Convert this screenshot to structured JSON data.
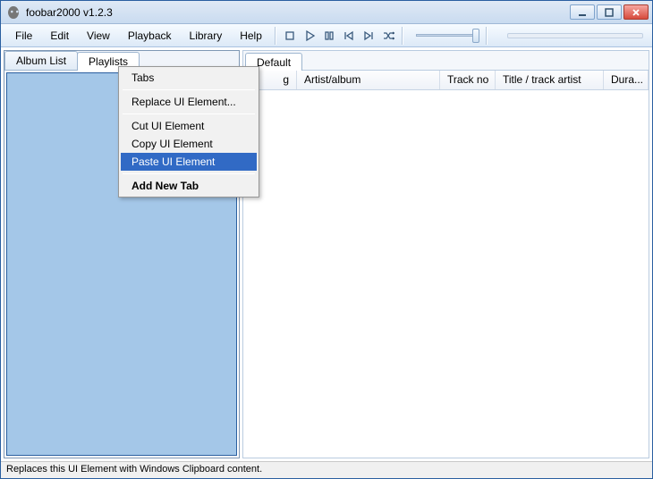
{
  "window": {
    "title": "foobar2000 v1.2.3"
  },
  "menu": {
    "file": "File",
    "edit": "Edit",
    "view": "View",
    "playback": "Playback",
    "library": "Library",
    "help": "Help"
  },
  "left": {
    "tab_album_list": "Album List",
    "tab_playlists": "Playlists"
  },
  "right": {
    "tab_default": "Default",
    "col_playing": "g",
    "col_artist_album": "Artist/album",
    "col_track_no": "Track no",
    "col_title": "Title / track artist",
    "col_duration": "Dura..."
  },
  "context": {
    "tabs": "Tabs",
    "replace": "Replace UI Element...",
    "cut": "Cut UI Element",
    "copy": "Copy UI Element",
    "paste": "Paste UI Element",
    "add_tab": "Add New Tab"
  },
  "status": {
    "text": "Replaces this UI Element with Windows Clipboard content."
  }
}
